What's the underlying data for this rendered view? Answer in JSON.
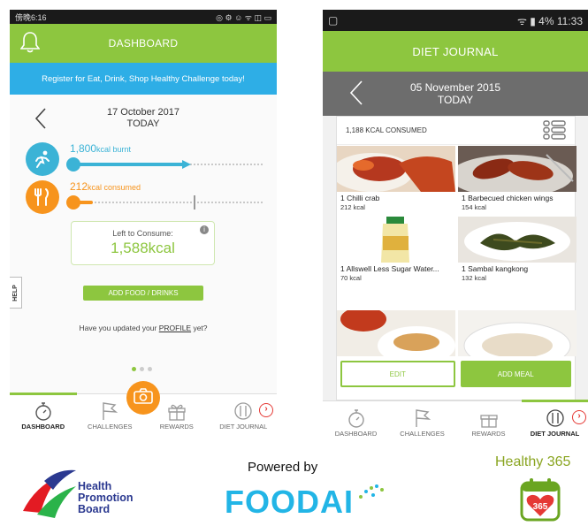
{
  "phone1": {
    "status_left": "傍晚6:16",
    "title": "DASHBOARD",
    "banner": "Register for Eat, Drink, Shop Healthy Challenge today!",
    "date": "17 October 2017",
    "date_sub": "TODAY",
    "burnt": {
      "value": "1,800",
      "unit": "kcal burnt",
      "progress": 0.6,
      "color": "#3bb3d6"
    },
    "consumed": {
      "value": "212",
      "unit": "kcal consumed",
      "progress": 0.12,
      "color": "#f7941d"
    },
    "left": {
      "label": "Left to Consume:",
      "value": "1,588",
      "unit": "kcal"
    },
    "add_button": "ADD FOOD / DRINKS",
    "profile_question_pre": "Have you updated your ",
    "profile_link": "PROFILE",
    "profile_question_post": " yet?",
    "help": "HELP",
    "tabs": [
      "DASHBOARD",
      "CHALLENGES",
      "REWARDS",
      "DIET JOURNAL"
    ]
  },
  "phone2": {
    "status_right": "4%  11:33",
    "title": "DIET JOURNAL",
    "date": "05 November 2015",
    "date_sub": "TODAY",
    "consumed_label": "1,188 KCAL CONSUMED",
    "items": [
      {
        "name": "1 Chilli crab",
        "kcal": "212 kcal"
      },
      {
        "name": "1 Barbecued chicken wings",
        "kcal": "154 kcal"
      },
      {
        "name": "1 Allswell Less Sugar Water...",
        "kcal": "70 kcal"
      },
      {
        "name": "1 Sambal kangkong",
        "kcal": "132 kcal"
      }
    ],
    "edit": "EDIT",
    "add_meal": "ADD MEAL",
    "tabs": [
      "DASHBOARD",
      "CHALLENGES",
      "REWARDS",
      "DIET JOURNAL"
    ]
  },
  "footer": {
    "hpb_line1": "Health",
    "hpb_line2": "Promotion",
    "hpb_line3": "Board",
    "powered_by": "Powered by",
    "foodai": "FOODAI",
    "healthy365": "Healthy 365",
    "cal_number": "365"
  },
  "colors": {
    "green": "#8dc63f",
    "blue": "#2eaee6",
    "orange": "#f7941d",
    "grey_bar": "#6d6d6d"
  }
}
